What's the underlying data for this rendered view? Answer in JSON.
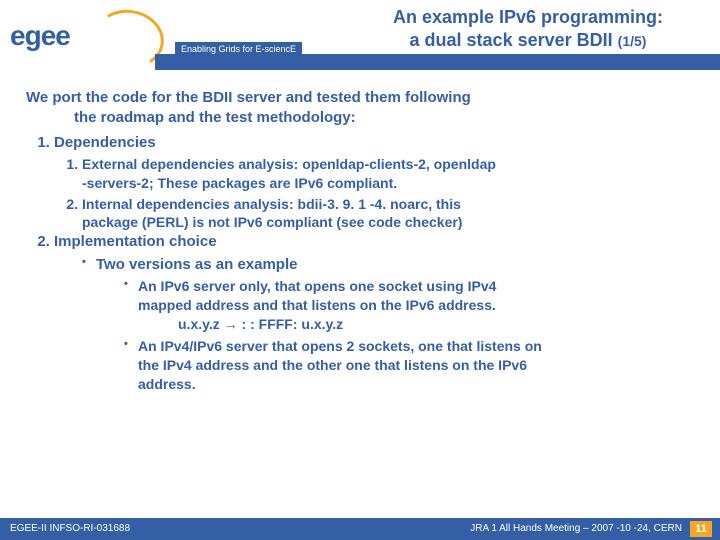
{
  "header": {
    "logo_text_parts": [
      "e",
      "g",
      "e",
      "e"
    ],
    "tagline": "Enabling Grids for E-sciencE",
    "title_line1": "An example IPv6 programming:",
    "title_line2": "a dual stack server BDII",
    "title_pager": "(1/5)"
  },
  "content": {
    "intro_l1": "We port the code for the BDII server and tested them following",
    "intro_l2": "the roadmap and the test methodology:",
    "dep_heading": "Dependencies",
    "dep_ext_label": "External dependencies analysis:",
    "dep_ext_rest_a": " openldap-clients-2, openldap",
    "dep_ext_rest_b": "-servers-2; These packages are IPv6 compliant.",
    "dep_int_label": "Internal dependencies analysis",
    "dep_int_rest_a": ": bdii-3. 9. 1 -4. noarc, this",
    "dep_int_rest_b": "package (PERL) is not IPv6 compliant (see code checker)",
    "impl_heading": "Implementation choice",
    "impl_two": "Two versions as an example",
    "impl_a_l1": "An IPv6 server only, that opens one socket using IPv4",
    "impl_a_l2": "mapped address and  that listens on the IPv6 address.",
    "impl_a_map_left": "u.x.y.z",
    "impl_a_map_arrow": "→",
    "impl_a_map_right": " : : FFFF: u.x.y.z",
    "impl_b_l1": "An IPv4/IPv6 server that opens 2 sockets, one that listens on",
    "impl_b_l2": "the IPv4 address and the other one that listens on the IPv6",
    "impl_b_l3": "address."
  },
  "footer": {
    "left": "EGEE-II INFSO-RI-031688",
    "center": "JRA 1 All Hands Meeting – 2007 -10 -24, CERN",
    "page": "11"
  }
}
